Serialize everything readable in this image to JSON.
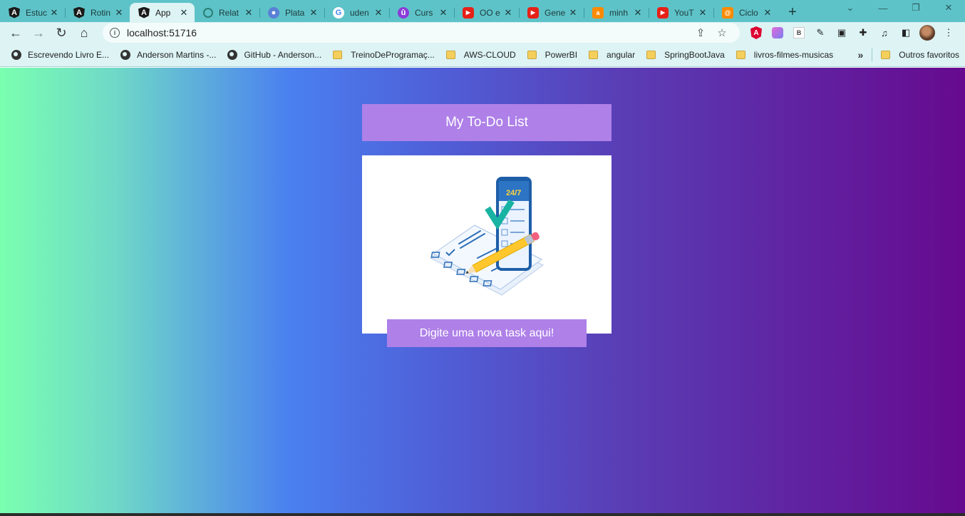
{
  "browser": {
    "tabs": [
      {
        "title": "Estuc",
        "favicon": "angular-icon",
        "active": false
      },
      {
        "title": "Rotin",
        "favicon": "angular-icon",
        "active": false
      },
      {
        "title": "App",
        "favicon": "angular-icon",
        "active": true
      },
      {
        "title": "Relat",
        "favicon": "chatgpt-icon",
        "active": false
      },
      {
        "title": "Plata",
        "favicon": "platform-icon",
        "active": false
      },
      {
        "title": "uden",
        "favicon": "google-icon",
        "active": false
      },
      {
        "title": "Curs",
        "favicon": "udemy-icon",
        "active": false
      },
      {
        "title": "OO e",
        "favicon": "youtube-icon",
        "active": false
      },
      {
        "title": "Gene",
        "favicon": "youtube-icon",
        "active": false
      },
      {
        "title": "minh",
        "favicon": "alura-icon",
        "active": false
      },
      {
        "title": "YouT",
        "favicon": "youtube-icon",
        "active": false
      },
      {
        "title": "Ciclo",
        "favicon": "ciclo-icon",
        "active": false
      }
    ],
    "new_tab_glyph": "+",
    "address": "localhost:51716",
    "bookmarks": [
      {
        "label": "Escrevendo Livro E...",
        "icon": "globe-icon"
      },
      {
        "label": "Anderson Martins -...",
        "icon": "globe-icon"
      },
      {
        "label": "GitHub - Anderson...",
        "icon": "globe-icon"
      },
      {
        "label": "TreinoDeProgramaç...",
        "icon": "folder-icon"
      },
      {
        "label": "AWS-CLOUD",
        "icon": "folder-icon"
      },
      {
        "label": "PowerBI",
        "icon": "folder-icon"
      },
      {
        "label": "angular",
        "icon": "folder-icon"
      },
      {
        "label": "SpringBootJava",
        "icon": "folder-icon"
      },
      {
        "label": "livros-filmes-musicas",
        "icon": "folder-icon"
      }
    ],
    "other_bookmarks": "Outros favoritos",
    "colors": {
      "tabstrip": "#5ec3c8",
      "toolbar": "#ddf3f4"
    }
  },
  "app": {
    "title": "My To-Do List",
    "task_placeholder": "Digite uma nova task aqui!",
    "illustration": "checklist-phone-illustration",
    "phone_badge": "24/7",
    "colors": {
      "accent": "#ae80e8",
      "gradient_start": "#7affb0",
      "gradient_mid": "#4a80f0",
      "gradient_end": "#660a8f"
    }
  }
}
